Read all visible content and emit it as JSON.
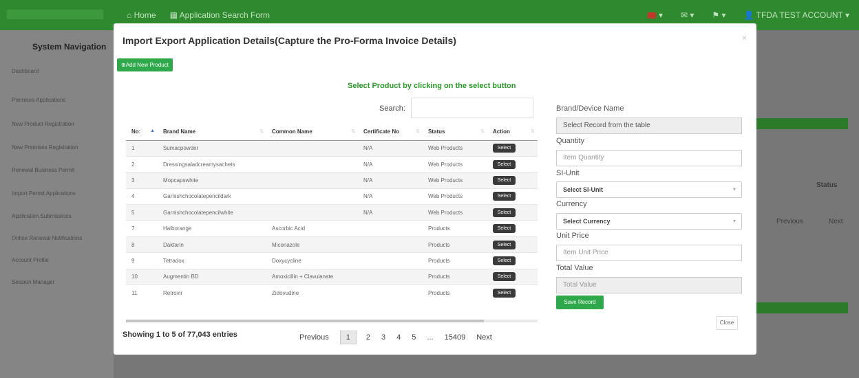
{
  "topbar": {
    "home": "Home",
    "application_search": "Application Search Form",
    "account": "TFDA TEST ACCOUNT"
  },
  "sidebar": {
    "title": "System Navigation",
    "items": [
      "Dashboard",
      "Premises Applications",
      "New Product Registration",
      "New Premises Registration",
      "Renewal Business Permit",
      "Import Permit Applications",
      "Application Submissions",
      "Online Renewal Notifications",
      "Account Profile",
      "Session Manager"
    ]
  },
  "modal": {
    "title": "Import Export Application Details(Capture the Pro-Forma Invoice Details)",
    "close_x": "×",
    "add_button": "Add New Product",
    "instruction": "Select Product by clicking on the select button",
    "search_label": "Search:"
  },
  "table": {
    "columns": [
      "No:",
      "Brand Name",
      "Common Name",
      "Certificate No",
      "Status",
      "Action"
    ],
    "select_label": "Select",
    "rows": [
      {
        "no": "1",
        "brand": "Sumacpowder",
        "common": "",
        "cert": "N/A",
        "status": "Web Products"
      },
      {
        "no": "2",
        "brand": "Dressingsaladcreamysachets",
        "common": "",
        "cert": "N/A",
        "status": "Web Products"
      },
      {
        "no": "3",
        "brand": "Mopcapswhite",
        "common": "",
        "cert": "N/A",
        "status": "Web Products"
      },
      {
        "no": "4",
        "brand": "Garnishchocolatepencildark",
        "common": "",
        "cert": "N/A",
        "status": "Web Products"
      },
      {
        "no": "5",
        "brand": "Garnishchocolatepencilwhite",
        "common": "",
        "cert": "N/A",
        "status": "Web Products"
      },
      {
        "no": "7",
        "brand": "Halborange",
        "common": "Ascorbic Acid",
        "cert": "",
        "status": "Products"
      },
      {
        "no": "8",
        "brand": "Daktarin",
        "common": "Miconazole",
        "cert": "",
        "status": "Products"
      },
      {
        "no": "9",
        "brand": "Tetradox",
        "common": "Doxycycline",
        "cert": "",
        "status": "Products"
      },
      {
        "no": "10",
        "brand": "Augmentin BD",
        "common": "Amoxicillin + Clavulanate",
        "cert": "",
        "status": "Products"
      },
      {
        "no": "11",
        "brand": "Retrovir",
        "common": "Zidovudine",
        "cert": "",
        "status": "Products"
      }
    ],
    "info": "Showing 1 to 5 of 77,043 entries"
  },
  "pager": {
    "previous": "Previous",
    "pages": [
      "1",
      "2",
      "3",
      "4",
      "5",
      "...",
      "15409"
    ],
    "next": "Next"
  },
  "form": {
    "brand_label": "Brand/Device Name",
    "brand_value": "Select Record from the table",
    "quantity_label": "Quantity",
    "quantity_placeholder": "Item Quantity",
    "siunit_label": "SI-Unit",
    "siunit_value": "Select SI-Unit",
    "currency_label": "Currency",
    "currency_value": "Select Currency",
    "unitprice_label": "Unit Price",
    "unitprice_placeholder": "Item Unit Price",
    "total_label": "Total Value",
    "total_placeholder": "Total Value",
    "save": "Save Record",
    "close": "Close"
  },
  "background": {
    "status": "Status",
    "previous": "Previous",
    "next": "Next"
  },
  "colors": {
    "accent_green": "#2ea84a",
    "topbar_green": "#2f8a2f",
    "instruction_green": "#2a9a2a"
  }
}
